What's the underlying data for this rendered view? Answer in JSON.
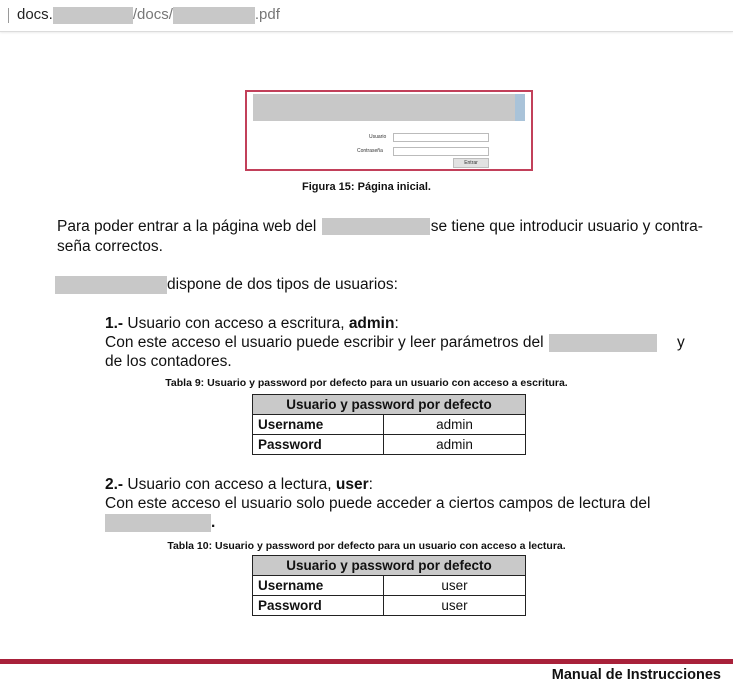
{
  "browser": {
    "url_host": "docs.",
    "url_path": "/docs/",
    "url_ext": ".pdf"
  },
  "figure": {
    "user_label": "Usuario",
    "password_label": "Contraseña",
    "button_label": "Entrar",
    "caption": "Figura 15: Página inicial."
  },
  "intro": {
    "line1_a": "Para poder entrar a la página web del",
    "line1_b": "se tiene que introducir usuario y contra-",
    "line2": "seña correctos.",
    "types_text": "dispone de dos tipos de usuarios:"
  },
  "section_write": {
    "num": "1.-",
    "title": " Usuario con acceso a escritura, ",
    "user": "admin",
    "colon": ":",
    "desc1": "Con este acceso el usuario puede escribir y leer parámetros del",
    "desc1_tail": "y",
    "desc2": "de los contadores.",
    "table_caption": "Tabla 9: Usuario y password por defecto para un usuario con acceso a escritura.",
    "table": {
      "header": "Usuario y password por defecto",
      "rows": [
        {
          "key": "Username",
          "value": "admin"
        },
        {
          "key": "Password",
          "value": "admin"
        }
      ]
    }
  },
  "section_read": {
    "num": "2.-",
    "title": " Usuario con acceso a lectura, ",
    "user": "user",
    "colon": ":",
    "desc1": "Con este acceso el usuario solo puede acceder a ciertos campos de lectura del",
    "desc2_tail": ".",
    "table_caption": "Tabla 10: Usuario y password por defecto para un usuario con acceso a lectura.",
    "table": {
      "header": "Usuario y password por defecto",
      "rows": [
        {
          "key": "Username",
          "value": "user"
        },
        {
          "key": "Password",
          "value": "user"
        }
      ]
    }
  },
  "footer": {
    "title": "Manual de Instrucciones"
  },
  "colors": {
    "accent": "#a8213a",
    "figure_border": "#c2405a",
    "table_header": "#c9c9c9",
    "redaction": "#c8c8c8"
  }
}
